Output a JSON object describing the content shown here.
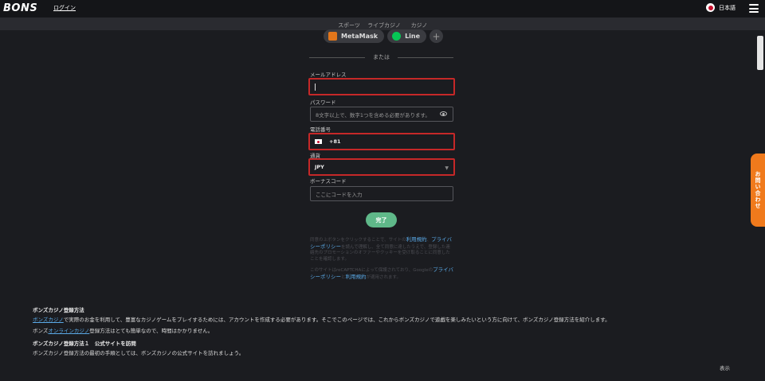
{
  "header": {
    "logo": "BONS",
    "login": "ログイン",
    "language": "日本語"
  },
  "tabs": [
    "スポーツ",
    "ライブカジノ",
    "カジノ"
  ],
  "social": {
    "metamask": "MetaMask",
    "line": "Line",
    "plus": "+"
  },
  "divider_text": "または",
  "form": {
    "email_label": "メールアドレス",
    "password_label": "パスワード",
    "password_placeholder": "8文字以上で、数字1つを含める必要があります。",
    "phone_label": "電話番号",
    "phone_code": "+81",
    "currency_label": "通貨",
    "currency_value": "JPY",
    "bonus_label": "ボーナスコード",
    "bonus_placeholder": "ここにコードを入力",
    "submit": "完了"
  },
  "terms": {
    "text1": "同意の上ボタンをクリックすることで、サイトの",
    "link1": "利用規約",
    "sep1": "、",
    "link2": "プライバシーポリシー",
    "text2": "を読んで理解し、全て同意に達したうえで、登録した連絡先のプロモーションのオファーやクッキーを受け取ることに同意したことを確認します。",
    "text3": "このサイトはreCAPTCHAによって保護されており、Googleの",
    "link3": "プライバシーポリシー",
    "sep2": "と",
    "link4": "利用規約",
    "text4": "が適用されます。"
  },
  "content": {
    "h1": "ボンズカジノ登録方法",
    "p1_link": "ボンズカジノ",
    "p1": "で実際のお金を利用して、豊富なカジノゲームをプレイするためには、アカウントを作成する必要があります。そこでこのページでは、これからボンズカジノで遊戯を楽しみたいという方に向けて、ボンズカジノ登録方法を紹介します。",
    "p2_pre": "ボンズ",
    "p2_link": "オンラインカジノ",
    "p2": "登録方法はとても簡単なので、時間はかかりません。",
    "h2": "ボンズカジノ登録方法１　公式サイトを訪問",
    "p3": "ボンズカジノ登録方法の最初の手順としては、ボンズカジノの公式サイトを訪れましょう。"
  },
  "contact": "お問い合わせ",
  "footer_label": "表示"
}
